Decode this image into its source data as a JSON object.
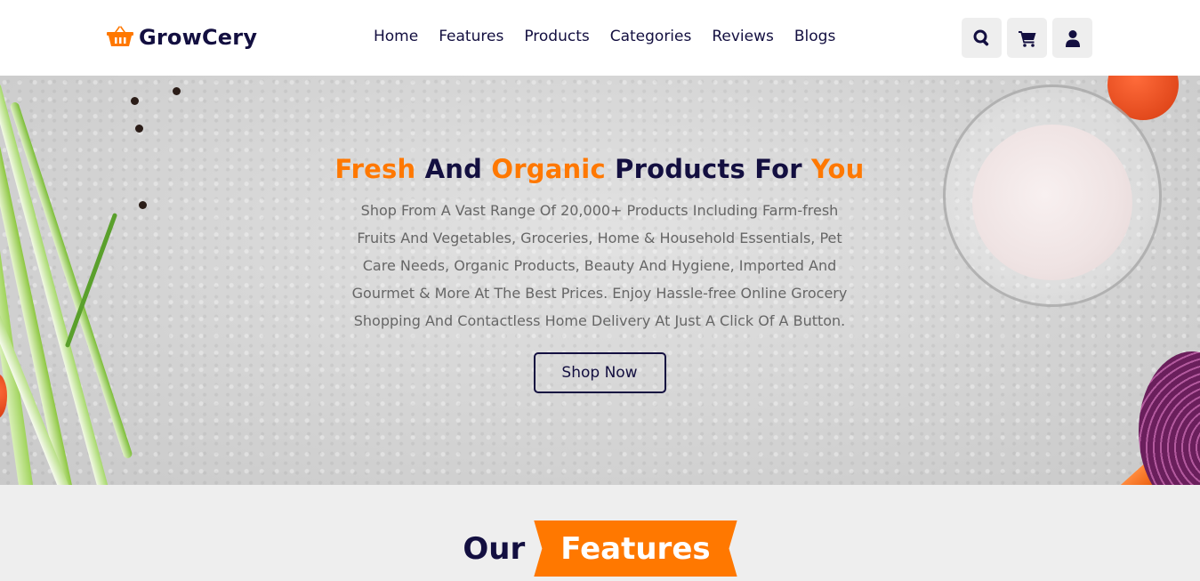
{
  "header": {
    "logo_text": "GrowCery",
    "nav": [
      "Home",
      "Features",
      "Products",
      "Categories",
      "Reviews",
      "Blogs"
    ],
    "icons": [
      "search-icon",
      "cart-icon",
      "user-icon"
    ]
  },
  "hero": {
    "title_parts": [
      "Fresh",
      "And",
      "Organic",
      "Products For",
      "You"
    ],
    "description": "Shop From A Vast Range Of 20,000+ Products Including Farm-fresh Fruits And Vegetables, Groceries, Home & Household Essentials, Pet Care Needs, Organic Products, Beauty And Hygiene, Imported And Gourmet & More At The Best Prices. Enjoy Hassle-free Online Grocery Shopping And Contactless Home Delivery At Just A Click Of A Button.",
    "button_label": "Shop Now"
  },
  "features": {
    "heading_plain": "Our",
    "heading_highlight": "Features"
  },
  "colors": {
    "accent": "#ff7800",
    "dark": "#130f40",
    "bg": "#eeeeee"
  }
}
